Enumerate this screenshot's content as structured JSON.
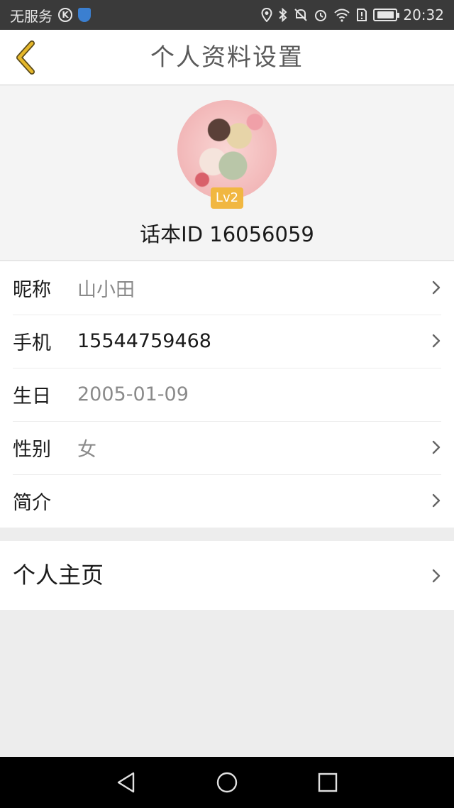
{
  "status_bar": {
    "carrier": "无服务",
    "time": "20:32",
    "icons": [
      "k-icon",
      "shield-icon",
      "location-icon",
      "bluetooth-icon",
      "mute-icon",
      "alarm-icon",
      "wifi-icon",
      "sim-alert-icon",
      "battery-icon"
    ]
  },
  "header": {
    "title": "个人资料设置",
    "back_icon": "chevron-left-icon",
    "accent_color": "#e5b72a"
  },
  "profile": {
    "level": "Lv2",
    "user_id_text": "话本ID 16056059"
  },
  "fields": [
    {
      "label": "昵称",
      "value": "山小田",
      "has_arrow": true
    },
    {
      "label": "手机",
      "value": "15544759468",
      "has_arrow": true
    },
    {
      "label": "生日",
      "value": "2005-01-09",
      "has_arrow": false
    },
    {
      "label": "性别",
      "value": "女",
      "has_arrow": true
    },
    {
      "label": "简介",
      "value": "",
      "has_arrow": true
    }
  ],
  "homepage": {
    "label": "个人主页"
  },
  "system_nav": [
    "back-triangle-icon",
    "home-circle-icon",
    "recents-square-icon"
  ]
}
